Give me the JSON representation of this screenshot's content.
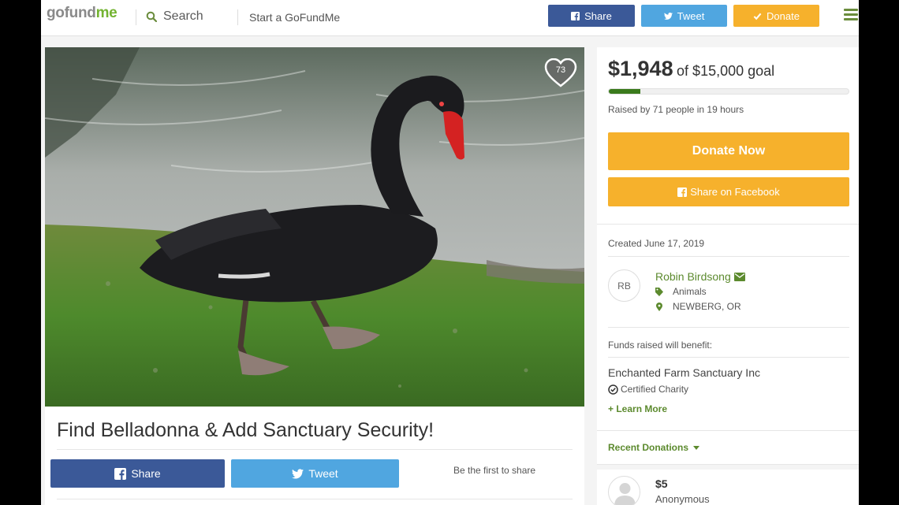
{
  "header": {
    "logo_prefix": "gofund",
    "logo_suffix": "me",
    "search_label": "Search",
    "start_label": "Start a GoFundMe",
    "share_label": "Share",
    "tweet_label": "Tweet",
    "donate_label": "Donate"
  },
  "colors": {
    "facebook": "#3b5998",
    "twitter": "#50a6e0",
    "donate": "#f6b12c",
    "brand_green": "#5c8a2e",
    "progress": "#3a7a1c"
  },
  "hero": {
    "image_subject": "black swan on grass by water",
    "heart_count": "73"
  },
  "campaign": {
    "title": "Find Belladonna & Add Sanctuary Security!",
    "share_label": "Share",
    "tweet_label": "Tweet",
    "first_to_share": "Be the first to share"
  },
  "donation": {
    "raised_amount": "$1,948",
    "goal_text": "of $15,000 goal",
    "progress_fraction": 0.13,
    "raised_by": "Raised by 71 people in 19 hours",
    "donate_now_label": "Donate Now",
    "share_facebook_label": "Share on Facebook"
  },
  "details": {
    "created": "Created June 17, 2019",
    "avatar_initials": "RB",
    "organizer": "Robin Birdsong",
    "category": "Animals",
    "location": "NEWBERG, OR",
    "funds_label": "Funds raised will benefit:",
    "charity_name": "Enchanted Farm Sanctuary Inc",
    "certified": "Certified Charity",
    "learn_more": "+ Learn More"
  },
  "recent": {
    "label": "Recent Donations",
    "donations": [
      {
        "amount": "$5",
        "name": "Anonymous"
      }
    ]
  }
}
